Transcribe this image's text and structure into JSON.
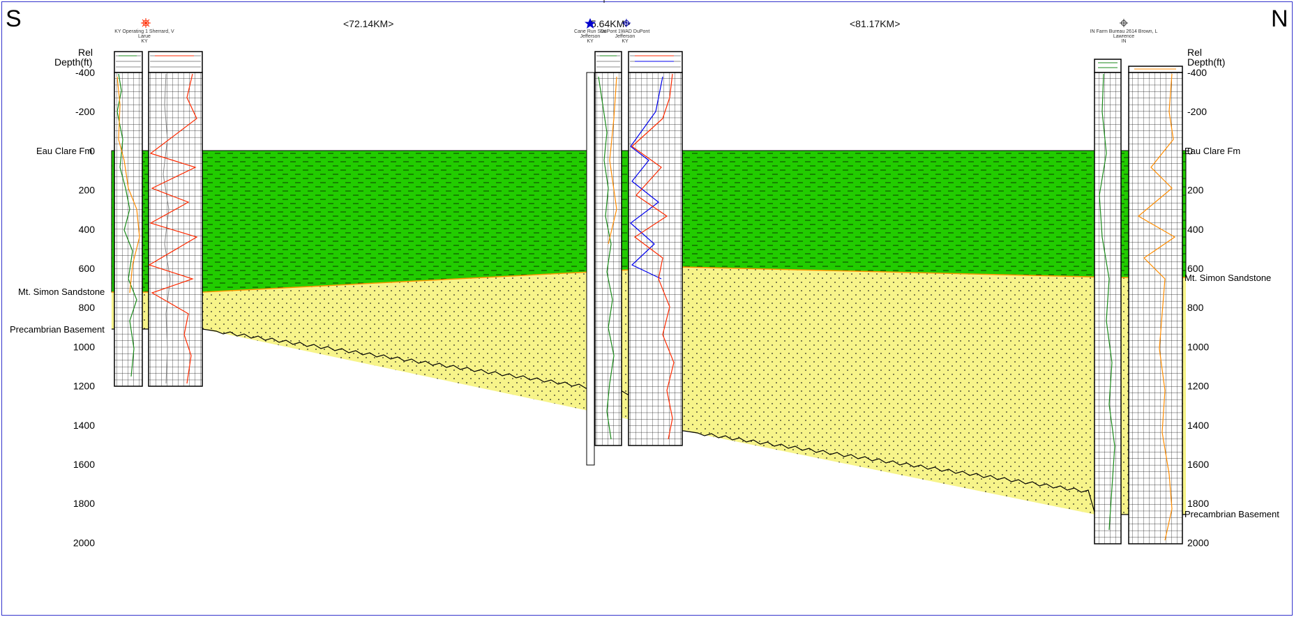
{
  "header": {
    "left_direction": "S",
    "right_direction": "N",
    "distances": [
      "<72.14KM>",
      "5.64KM>",
      "<81.17KM>"
    ]
  },
  "axis": {
    "title_line1": "Rel",
    "title_line2": "Depth(ft)",
    "ticks": [
      "-400",
      "-200",
      "0",
      "200",
      "400",
      "600",
      "800",
      "1000",
      "1200",
      "1400",
      "1600",
      "1800",
      "2000"
    ],
    "right_ticks": [
      "-400",
      "-200",
      "0",
      "200",
      "400",
      "600",
      "800",
      "1000",
      "1200",
      "1400",
      "1600",
      "1800",
      "2000"
    ]
  },
  "formations": {
    "eau_claire": {
      "name": "Eau Clare Fm",
      "color": "#22cc00"
    },
    "mt_simon": {
      "name": "Mt. Simon Sandstone",
      "color": "#f7f48a"
    },
    "basement": {
      "name": "Precambrian Basement"
    }
  },
  "wells": [
    {
      "label_line1": "KY Operating 1 Sherrard, V",
      "label_line2": "Larue",
      "label_line3": "KY",
      "symbol": "red-dry-hole-star-icon"
    },
    {
      "label_line1": "Cane Run Stat",
      "label_line2": "Jefferson",
      "label_line3": "KY",
      "symbol": "blue-star-icon"
    },
    {
      "label_line1": "DuPont 1WAD DuPont",
      "label_line2": "Jefferson",
      "label_line3": "KY",
      "symbol": "dry-hole-icon"
    },
    {
      "label_line1": "IN Farm Bureau 2614 Brown, L",
      "label_line2": "Lawrence",
      "label_line3": "IN",
      "symbol": "dry-hole-icon"
    }
  ],
  "colors": {
    "gamma_ray": "#1a8a1a",
    "resistivity": "#ff2a00",
    "density": "#ff8c00",
    "neutron": "#0000ee",
    "caliper": "#888888",
    "frame": "#3333cc"
  }
}
